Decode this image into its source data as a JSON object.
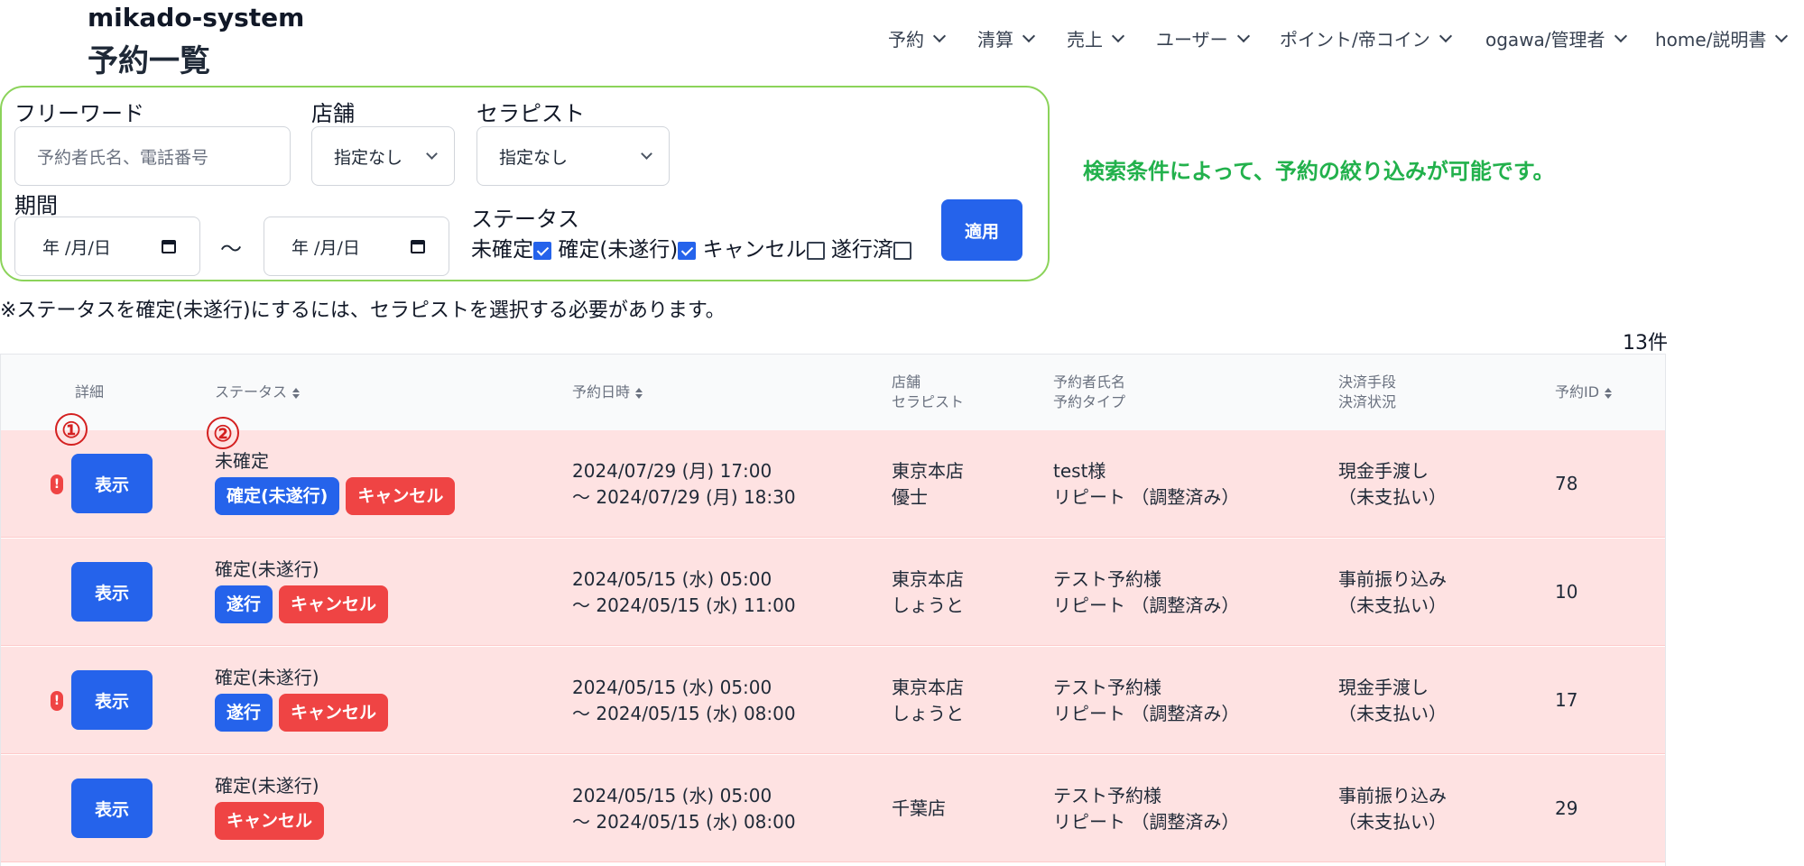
{
  "app_name": "mikado-system",
  "page_title": "予約一覧",
  "nav": [
    "予約",
    "清算",
    "売上",
    "ユーザー",
    "ポイント/帝コイン",
    "ogawa/管理者",
    "home/説明書"
  ],
  "search": {
    "freeword_label": "フリーワード",
    "freeword_placeholder": "予約者氏名、電話番号",
    "store_label": "店舗",
    "store_value": "指定なし",
    "therapist_label": "セラピスト",
    "therapist_value": "指定なし",
    "period_label": "期間",
    "date_from": "年 /月/日",
    "date_sep": "〜",
    "date_to": "年 /月/日",
    "status_label": "ステータス",
    "status_options": [
      {
        "label": "未確定",
        "checked": true
      },
      {
        "label": "確定(未遂行)",
        "checked": true
      },
      {
        "label": "キャンセル",
        "checked": false
      },
      {
        "label": "遂行済",
        "checked": false
      }
    ],
    "apply_label": "適用",
    "hint": "検索条件によって、予約の絞り込みが可能です。"
  },
  "note": "※ステータスを確定(未遂行)にするには、セラピストを選択する必要があります。",
  "count": "13件",
  "annotations": [
    "①",
    "②"
  ],
  "table": {
    "headers": {
      "detail": "詳細",
      "status": "ステータス",
      "datetime": "予約日時",
      "store": "店舗",
      "therapist": "セラピスト",
      "customer": "予約者氏名",
      "type": "予約タイプ",
      "payment": "決済手段",
      "payment_status": "決済状況",
      "id": "予約ID"
    },
    "show_label": "表示",
    "rows": [
      {
        "alert": true,
        "status": "未確定",
        "actions": [
          {
            "label": "確定(未遂行)",
            "color": "blue"
          },
          {
            "label": "キャンセル",
            "color": "red"
          }
        ],
        "start": "2024/07/29 (月) 17:00",
        "end": "〜 2024/07/29 (月) 18:30",
        "store": "東京本店",
        "therapist": "優士",
        "customer": "test様",
        "type": "リピート （調整済み）",
        "payment": "現金手渡し",
        "payment_status": "（未支払い）",
        "id": "78"
      },
      {
        "alert": false,
        "status": "確定(未遂行)",
        "actions": [
          {
            "label": "遂行",
            "color": "blue"
          },
          {
            "label": "キャンセル",
            "color": "red"
          }
        ],
        "start": "2024/05/15 (水) 05:00",
        "end": "〜 2024/05/15 (水) 11:00",
        "store": "東京本店",
        "therapist": "しょうと",
        "customer": "テスト予約様",
        "type": "リピート （調整済み）",
        "payment": "事前振り込み",
        "payment_status": "（未支払い）",
        "id": "10"
      },
      {
        "alert": true,
        "status": "確定(未遂行)",
        "actions": [
          {
            "label": "遂行",
            "color": "blue"
          },
          {
            "label": "キャンセル",
            "color": "red"
          }
        ],
        "start": "2024/05/15 (水) 05:00",
        "end": "〜 2024/05/15 (水) 08:00",
        "store": "東京本店",
        "therapist": "しょうと",
        "customer": "テスト予約様",
        "type": "リピート （調整済み）",
        "payment": "現金手渡し",
        "payment_status": "（未支払い）",
        "id": "17"
      },
      {
        "alert": false,
        "status": "確定(未遂行)",
        "actions": [
          {
            "label": "キャンセル",
            "color": "red"
          }
        ],
        "start": "2024/05/15 (水) 05:00",
        "end": "〜 2024/05/15 (水) 08:00",
        "store": "千葉店",
        "therapist": "",
        "customer": "テスト予約様",
        "type": "リピート （調整済み）",
        "payment": "事前振り込み",
        "payment_status": "（未支払い）",
        "id": "29"
      }
    ]
  },
  "colors": {
    "primary": "#2563eb",
    "danger": "#ef4444",
    "row_bg": "#fee2e2",
    "hint": "#22b14c",
    "box_border": "#8bd35a",
    "annotation": "#d42020"
  }
}
